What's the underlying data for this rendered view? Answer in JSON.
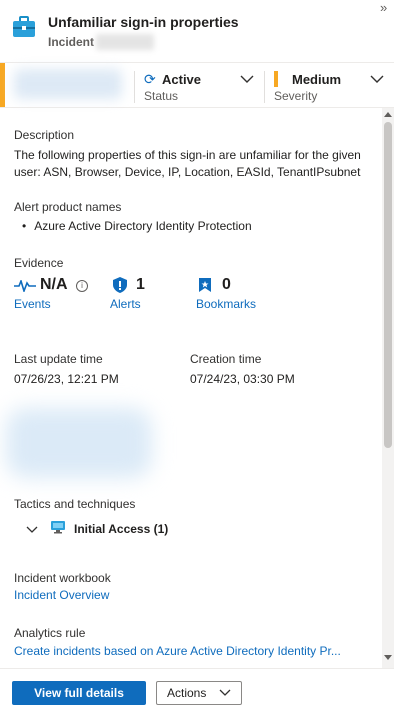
{
  "header": {
    "title": "Unfamiliar sign-in properties",
    "subtitle": "Incident",
    "expand_glyph": "»"
  },
  "status_bar": {
    "status_value": "Active",
    "status_label": "Status",
    "severity_value": "Medium",
    "severity_label": "Severity",
    "severity_color": "#f7a823",
    "accent_color": "#f7a823"
  },
  "description": {
    "label": "Description",
    "text": "The following properties of this sign-in are unfamiliar for the given user: ASN, Browser, Device, IP, Location, EASId, TenantIPsubnet"
  },
  "alert_products": {
    "label": "Alert product names",
    "items": [
      "Azure Active Directory Identity Protection"
    ]
  },
  "evidence": {
    "label": "Evidence",
    "events": {
      "value": "N/A",
      "label": "Events"
    },
    "alerts": {
      "value": "1",
      "label": "Alerts"
    },
    "bookmarks": {
      "value": "0",
      "label": "Bookmarks"
    }
  },
  "times": {
    "last_update_label": "Last update time",
    "last_update_value": "07/26/23, 12:21 PM",
    "creation_label": "Creation time",
    "creation_value": "07/24/23, 03:30 PM"
  },
  "tactics": {
    "label": "Tactics and techniques",
    "item": "Initial Access (1)"
  },
  "workbook": {
    "label": "Incident workbook",
    "link": "Incident Overview"
  },
  "analytics": {
    "label": "Analytics rule",
    "link": "Create incidents based on Azure Active Directory Identity Pr..."
  },
  "footer": {
    "primary": "View full details",
    "secondary": "Actions"
  },
  "colors": {
    "brand": "#0f6cbd",
    "accent": "#f7a823"
  }
}
